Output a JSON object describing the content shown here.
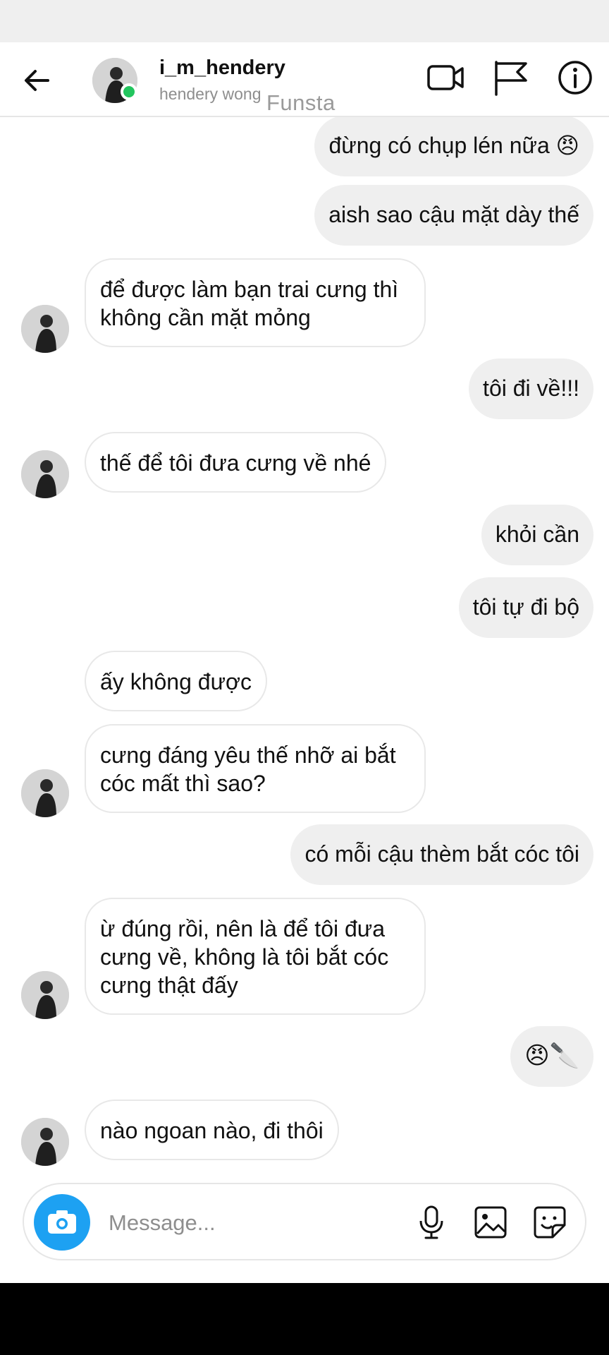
{
  "header": {
    "username": "i_m_hendery",
    "full_name": "hendery wong",
    "watermark": "Funsta"
  },
  "composer": {
    "placeholder": "Message..."
  },
  "messages": [
    {
      "side": "out",
      "text": "đừng có chụp lén nữa 😠"
    },
    {
      "side": "out",
      "text": "aish sao cậu mặt dày thế"
    },
    {
      "side": "in",
      "text": "để được làm bạn trai cưng thì không cần mặt mỏng"
    },
    {
      "side": "out",
      "text": "tôi đi về!!!"
    },
    {
      "side": "in",
      "text": "thế để tôi đưa cưng về nhé"
    },
    {
      "side": "out",
      "text": "khỏi cần"
    },
    {
      "side": "out",
      "text": "tôi tự đi bộ"
    },
    {
      "side": "in",
      "text": "ấy không được"
    },
    {
      "side": "in",
      "text": "cưng đáng yêu thế nhỡ ai bắt cóc mất thì sao?"
    },
    {
      "side": "out",
      "text": "có mỗi cậu thèm bắt cóc tôi"
    },
    {
      "side": "in",
      "text": "ừ đúng rồi, nên là để tôi đưa cưng về, không là tôi bắt cóc cưng thật đấy"
    },
    {
      "side": "out",
      "text": "😠🔪"
    },
    {
      "side": "in",
      "text": "nào ngoan nào, đi thôi"
    }
  ]
}
